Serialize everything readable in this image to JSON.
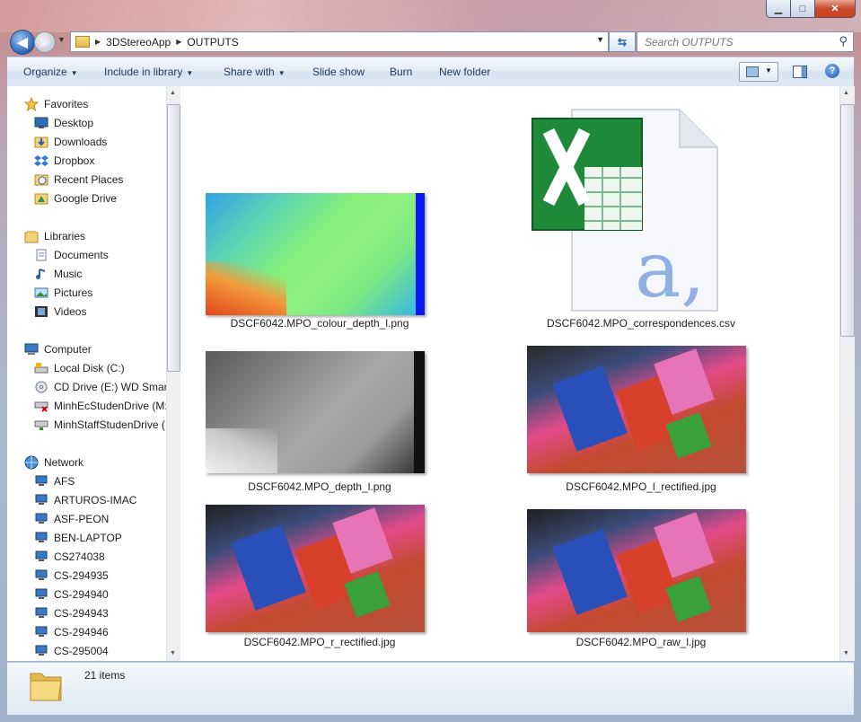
{
  "window": {
    "minimize": "▁",
    "maximize": "□",
    "close": "✕"
  },
  "address": {
    "crumbs": [
      "3DStereoApp",
      "OUTPUTS"
    ],
    "search_placeholder": "Search OUTPUTS"
  },
  "toolbar": {
    "organize": "Organize",
    "include_in_library": "Include in library",
    "share_with": "Share with",
    "slide_show": "Slide show",
    "burn": "Burn",
    "new_folder": "New folder"
  },
  "nav": {
    "favorites": {
      "label": "Favorites",
      "items": [
        "Desktop",
        "Downloads",
        "Dropbox",
        "Recent Places",
        "Google Drive"
      ]
    },
    "libraries": {
      "label": "Libraries",
      "items": [
        "Documents",
        "Music",
        "Pictures",
        "Videos"
      ]
    },
    "computer": {
      "label": "Computer",
      "items": [
        "Local Disk (C:)",
        "CD Drive (E:) WD SmartW",
        "MinhEcStudenDrive (M:",
        "MinhStaffStudenDrive (I"
      ]
    },
    "network": {
      "label": "Network",
      "items": [
        "AFS",
        "ARTUROS-IMAC",
        "ASF-PEON",
        "BEN-LAPTOP",
        "CS274038",
        "CS-294935",
        "CS-294940",
        "CS-294943",
        "CS-294946",
        "CS-295004"
      ]
    }
  },
  "files": [
    {
      "name": "DSCF6042.MPO_colour_depth_l.png",
      "kind": "colour-depth"
    },
    {
      "name": "DSCF6042.MPO_correspondences.csv",
      "kind": "excel"
    },
    {
      "name": "DSCF6042.MPO_depth_l.png",
      "kind": "depth"
    },
    {
      "name": "DSCF6042.MPO_l_rectified.jpg",
      "kind": "photo"
    },
    {
      "name": "DSCF6042.MPO_r_rectified.jpg",
      "kind": "photo"
    },
    {
      "name": "DSCF6042.MPO_raw_l.jpg",
      "kind": "photo"
    }
  ],
  "details": {
    "item_count": "21 items"
  },
  "colors": {
    "accent": "#1e395b",
    "selection": "#cce8ff"
  }
}
